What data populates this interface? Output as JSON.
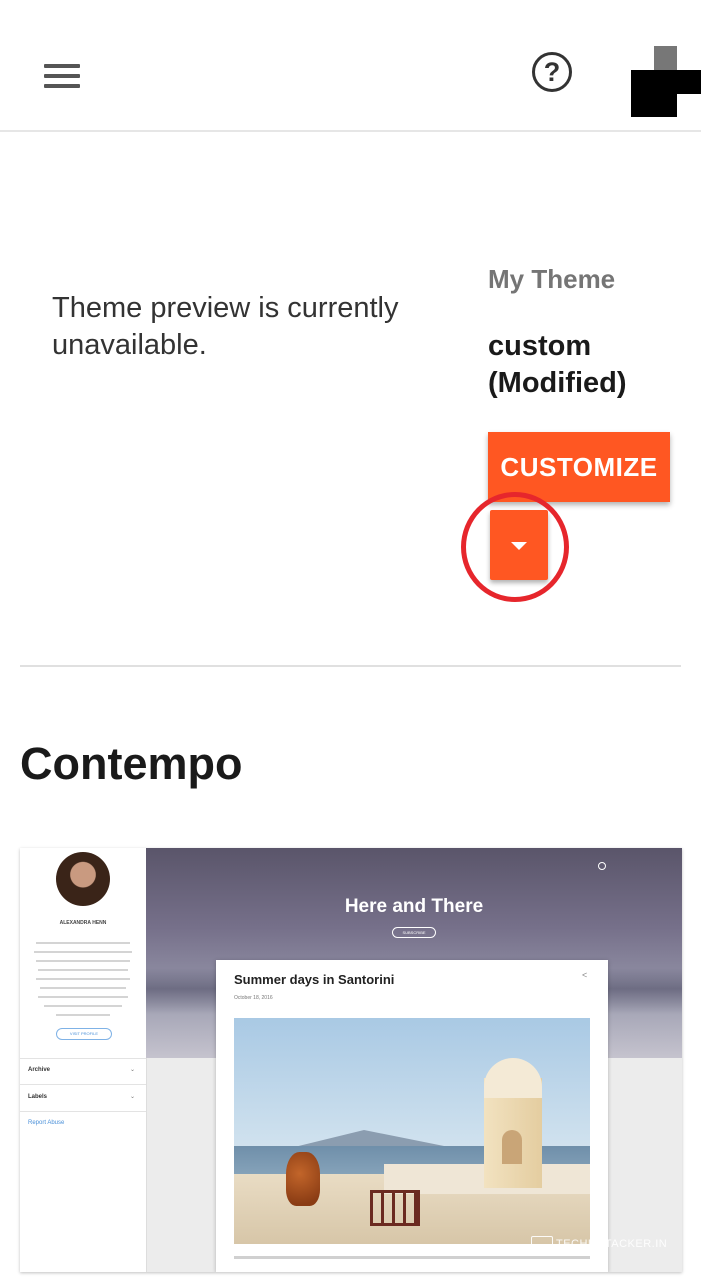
{
  "topbar": {
    "menu_icon": "hamburger-menu-icon",
    "help_icon": "help-circle-icon",
    "help_glyph": "?"
  },
  "preview": {
    "message": "Theme preview is currently unavailable."
  },
  "my_theme": {
    "label": "My Theme",
    "name": "custom (Modified)",
    "customize_label": "CUSTOMIZE",
    "dropdown_icon": "caret-down-icon",
    "accent_color": "#ff5722",
    "highlight_color": "#e6262c"
  },
  "theme_section": {
    "title": "Contempo",
    "thumbnail": {
      "profile_name": "ALEXANDRA HENN",
      "profile_button": "VISIT PROFILE",
      "nav_items": [
        "Archive",
        "Labels"
      ],
      "report_link": "Report Abuse",
      "blog_title": "Here and There",
      "subscribe_label": "SUBSCRIBE",
      "post_title": "Summer days in Santorini",
      "post_date": "October 18, 2016",
      "watermark": "TECHUNTACKER.IN"
    }
  }
}
